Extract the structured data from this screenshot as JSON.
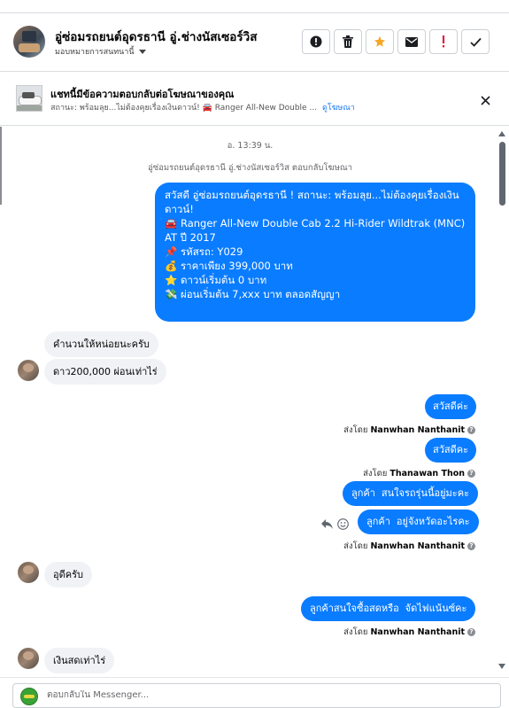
{
  "header": {
    "page_name": "อู่ซ่อมรถยนต์อุดรธานี อู่.ช่างนัสเซอร์วิส",
    "assign_label": "มอบหมายการสนทนานี้",
    "actions": [
      "alert-icon",
      "trash-icon",
      "star-icon",
      "envelope-icon",
      "exclamation-icon",
      "check-icon"
    ]
  },
  "ad": {
    "title": "แชทนี้มีข้อความตอบกลับต่อโฆษณาของคุณ",
    "subtitle": "สถานะ: พร้อมลุย...ไม่ต้องคุยเรื่องเงินดาวน์! 🚘 Ranger All-New Double ...",
    "link": "ดูโฆษณา"
  },
  "chat": {
    "time": "อ. 13:39 น.",
    "reply_note": "อู่ซ่อมรถยนต์อุดรธานี อู่.ช่างนัสเซอร์วิส ตอบกลับโฆษณา",
    "ad_message_lines": [
      "สวัสดี อู่ซ่อมรถยนต์อุดรธานี ! สถานะ: พร้อมลุย...ไม่ต้องคุยเรื่องเงินดาวน์!",
      "🚘 Ranger All-New Double Cab 2.2 Hi-Rider Wildtrak (MNC) AT ปี 2017",
      "",
      "📌 รหัสรถ: Y029",
      "💰 ราคาเพียง 399,000 บาท",
      "⭐ ดาวน์เริ่มต้น 0 บาท",
      "💸 ผ่อนเริ่มต้น 7,xxx บาท ตลอดสัญญา"
    ],
    "in_msg_1": "คำนวนให้หน่อยนะครับ",
    "in_msg_2": "ดาว200,000 ผ่อนเท่าไร่",
    "out_msg_1": "สวัสดีค่ะ",
    "sent_by_prefix": "ส่งโดย",
    "sender_1": "Nanwhan Nanthanit",
    "out_msg_2": "สวัสดีคะ",
    "sender_2": "Thanawan Thon",
    "out_msg_3": "ลูกค้า  สนใจรถรุ่นนี้อยู่มะคะ",
    "out_msg_4": "ลูกค้า  อยู่จังหวัดอะไรคะ",
    "sender_3": "Nanwhan Nanthanit",
    "in_msg_3": "อุดีครับ",
    "out_msg_5": "ลูกค้าสนใจซื้อสดหรือ  จัดไฟแน้นซ์คะ",
    "sender_4": "Nanwhan Nanthanit",
    "in_msg_4": "เงินสดเท่าไร่"
  },
  "composer": {
    "placeholder": "ตอบกลับใน Messenger..."
  },
  "colors": {
    "accent": "#0a7cff",
    "incoming": "#f0f2f5",
    "star": "#f5a623",
    "alert": "#e41e3f"
  }
}
